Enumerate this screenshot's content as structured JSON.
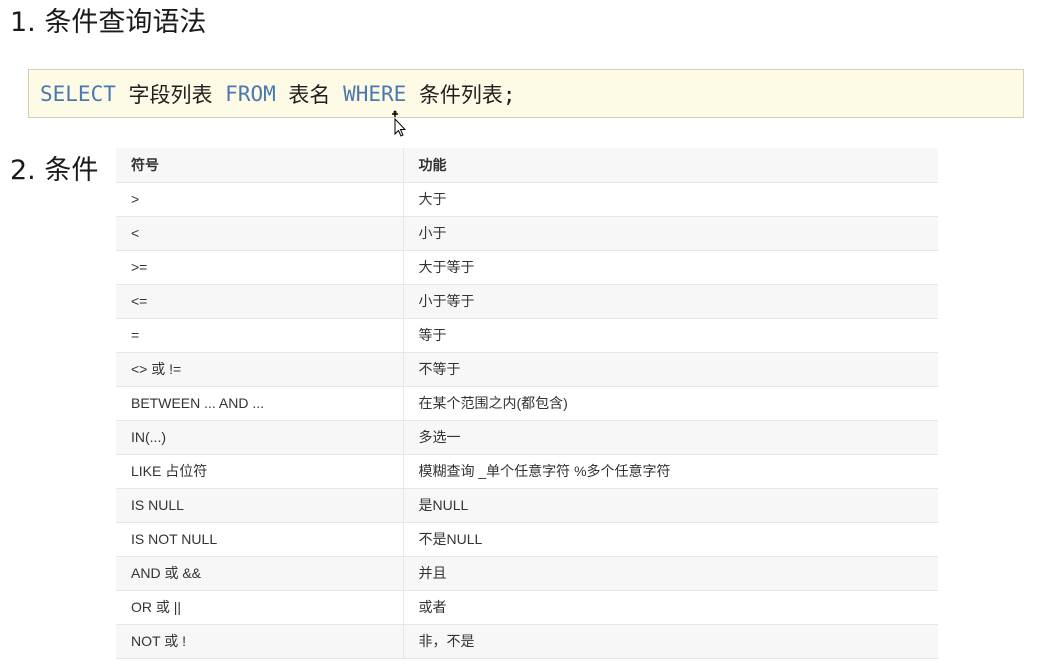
{
  "section1": {
    "title": "1. 条件查询语法"
  },
  "code": {
    "kw_select": "SELECT",
    "fields": "字段列表",
    "kw_from": "FROM",
    "table": "表名",
    "kw_where": "WHERE",
    "conditions": "条件列表;"
  },
  "section2": {
    "title": "2. 条件"
  },
  "table": {
    "headers": [
      "符号",
      "功能"
    ],
    "rows": [
      [
        ">",
        "大于"
      ],
      [
        "<",
        "小于"
      ],
      [
        ">=",
        "大于等于"
      ],
      [
        "<=",
        "小于等于"
      ],
      [
        "=",
        "等于"
      ],
      [
        "<> 或 !=",
        "不等于"
      ],
      [
        "BETWEEN ... AND ...",
        "在某个范围之内(都包含)"
      ],
      [
        "IN(...)",
        "多选一"
      ],
      [
        "LIKE 占位符",
        "模糊查询  _单个任意字符  %多个任意字符"
      ],
      [
        "IS NULL",
        "是NULL"
      ],
      [
        "IS NOT NULL",
        "不是NULL"
      ],
      [
        "AND 或 &&",
        "并且"
      ],
      [
        "OR 或 ||",
        "或者"
      ],
      [
        "NOT 或 !",
        "非，不是"
      ]
    ]
  },
  "colors": {
    "keyword": "#4a78b0",
    "code_bg": "#fdfbe6",
    "row_alt": "#f7f7f7"
  }
}
